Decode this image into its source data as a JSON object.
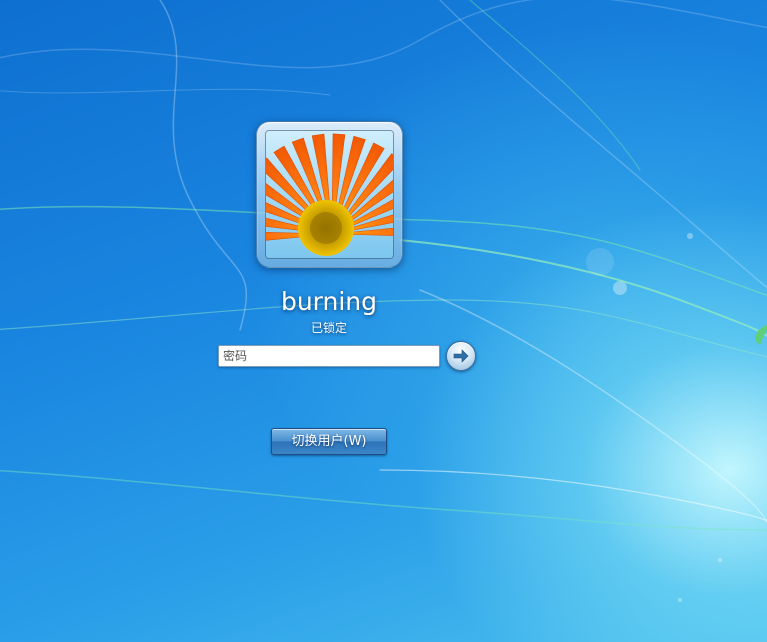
{
  "user": {
    "name": "burning",
    "status": "已锁定"
  },
  "password": {
    "placeholder": "密码",
    "value": ""
  },
  "actions": {
    "submit_icon": "arrow-right-icon",
    "switch_user_label": "切换用户(W)"
  },
  "colors": {
    "background_dark": "#0e6fd0",
    "background_light": "#4bc0ee",
    "button_blue": "#4a90cf",
    "avatar_flower": "#f57c12",
    "avatar_sky": "#8fd0f0"
  }
}
